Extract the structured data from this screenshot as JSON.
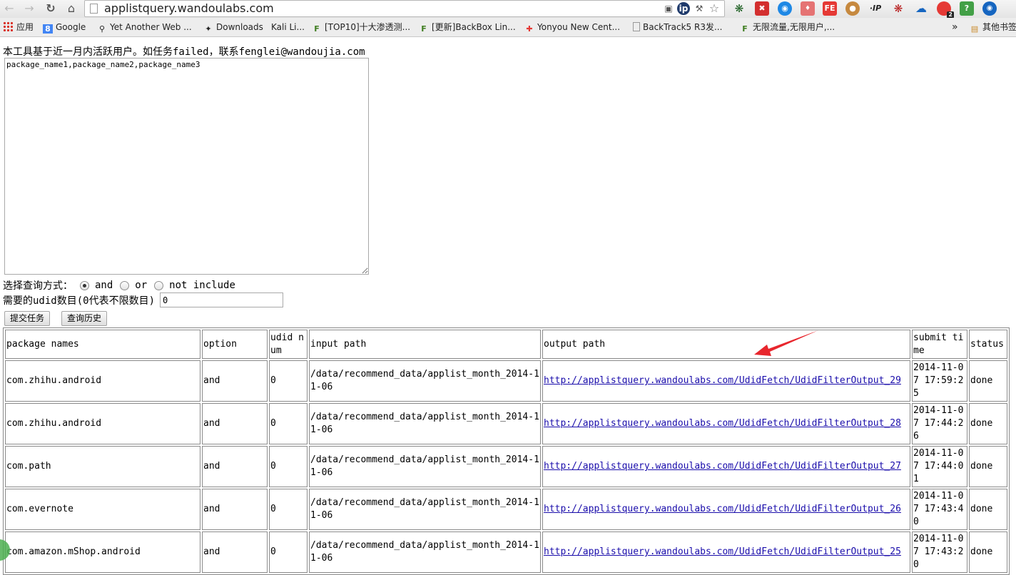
{
  "browser": {
    "url": "applistquery.wandoulabs.com",
    "bookmarks": [
      {
        "label": "应用",
        "icon": "apps-grid-icon"
      },
      {
        "label": "Google",
        "icon": "google-icon"
      },
      {
        "label": "Yet Another Web ...",
        "icon": "magnifier-icon"
      },
      {
        "label": "Downloads",
        "icon": "dragon-icon"
      },
      {
        "label": "Kali Li...",
        "icon": "kali-icon"
      },
      {
        "label": "[TOP10]十大渗透测...",
        "icon": "freebuf-icon"
      },
      {
        "label": "[更新]BackBox Lin...",
        "icon": "freebuf-icon"
      },
      {
        "label": "Yonyou New Cent...",
        "icon": "yonyou-icon"
      },
      {
        "label": "BackTrack5 R3发...",
        "icon": "page-icon"
      },
      {
        "label": "无限流量,无限用户,...",
        "icon": "freebuf-icon"
      },
      {
        "label": "其他书签",
        "icon": "folder-icon"
      }
    ],
    "bookmarks_overflow": "»",
    "ext_labels": {
      "ip": "·IP",
      "fe": "FE",
      "badge_2": "2",
      "help": "?"
    }
  },
  "page": {
    "notice": "本工具基于近一月内活跃用户。如任务failed，联系fenglei@wandoujia.com",
    "textarea_value": "package_name1,package_name2,package_name3",
    "query_mode_label": "选择查询方式：",
    "options": [
      "and",
      "or",
      "not include"
    ],
    "selected_option": "and",
    "udid_label": "需要的udid数目(0代表不限数目)",
    "udid_value": "0",
    "submit_button": "提交任务",
    "history_button": "查询历史"
  },
  "table": {
    "headers": [
      "package names",
      "option",
      "udid num",
      "input path",
      "output path",
      "submit time",
      "status"
    ],
    "rows": [
      {
        "package": "com.zhihu.android",
        "option": "and",
        "udid": "0",
        "input": "/data/recommend_data/applist_month_2014-11-06",
        "output": "http://applistquery.wandoulabs.com/UdidFetch/UdidFilterOutput_29",
        "time": "2014-11-07 17:59:25",
        "status": "done"
      },
      {
        "package": "com.zhihu.android",
        "option": "and",
        "udid": "0",
        "input": "/data/recommend_data/applist_month_2014-11-06",
        "output": "http://applistquery.wandoulabs.com/UdidFetch/UdidFilterOutput_28",
        "time": "2014-11-07 17:44:26",
        "status": "done"
      },
      {
        "package": "com.path",
        "option": "and",
        "udid": "0",
        "input": "/data/recommend_data/applist_month_2014-11-06",
        "output": "http://applistquery.wandoulabs.com/UdidFetch/UdidFilterOutput_27",
        "time": "2014-11-07 17:44:01",
        "status": "done"
      },
      {
        "package": "com.evernote",
        "option": "and",
        "udid": "0",
        "input": "/data/recommend_data/applist_month_2014-11-06",
        "output": "http://applistquery.wandoulabs.com/UdidFetch/UdidFilterOutput_26",
        "time": "2014-11-07 17:43:40",
        "status": "done"
      },
      {
        "package": "com.amazon.mShop.android",
        "option": "and",
        "udid": "0",
        "input": "/data/recommend_data/applist_month_2014-11-06",
        "output": "http://applistquery.wandoulabs.com/UdidFetch/UdidFilterOutput_25",
        "time": "2014-11-07 17:43:20",
        "status": "done"
      }
    ]
  },
  "colors": {
    "link": "#1a0dab",
    "annotation_arrow": "#e8262d",
    "accent_green": "#4caf50"
  }
}
